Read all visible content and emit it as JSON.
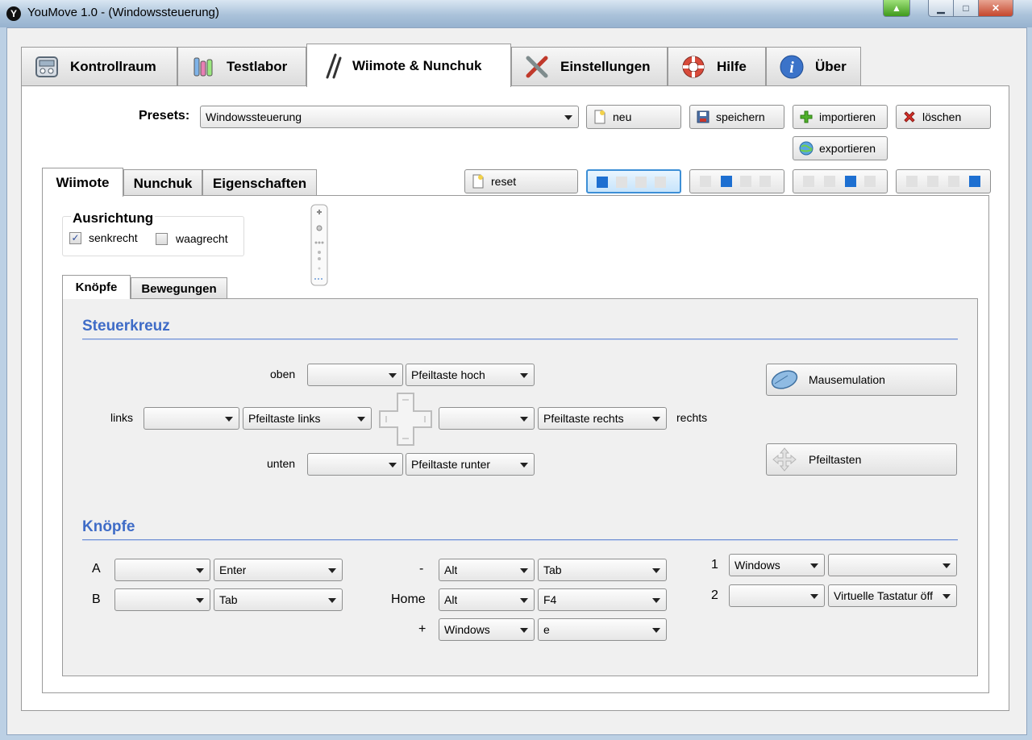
{
  "window": {
    "title": "YouMove 1.0 - (Windowssteuerung)",
    "app_icon": "youmove-app-icon"
  },
  "main_tabs": [
    {
      "label": "Kontrollraum",
      "icon": "control-room-icon"
    },
    {
      "label": "Testlabor",
      "icon": "test-lab-icon"
    },
    {
      "label": "Wiimote & Nunchuk",
      "icon": "wiimote-icon",
      "active": true
    },
    {
      "label": "Einstellungen",
      "icon": "tools-icon"
    },
    {
      "label": "Hilfe",
      "icon": "lifebuoy-icon"
    },
    {
      "label": "Über",
      "icon": "info-icon"
    }
  ],
  "presets": {
    "label": "Presets:",
    "selected": "Windowssteuerung",
    "new_label": "neu",
    "save_label": "speichern",
    "import_label": "importieren",
    "delete_label": "löschen",
    "export_label": "exportieren",
    "reset_label": "reset"
  },
  "sub_tabs": [
    {
      "label": "Wiimote",
      "active": true
    },
    {
      "label": "Nunchuk"
    },
    {
      "label": "Eigenschaften"
    }
  ],
  "orientation": {
    "title": "Ausrichtung",
    "vertical_label": "senkrecht",
    "vertical_checked": true,
    "horizontal_label": "waagrecht",
    "horizontal_checked": false
  },
  "inner_tabs": [
    {
      "label": "Knöpfe",
      "active": true
    },
    {
      "label": "Bewegungen"
    }
  ],
  "dpad": {
    "title": "Steuerkreuz",
    "up_label": "oben",
    "up_key": "Pfeiltaste hoch",
    "left_label": "links",
    "left_key": "Pfeiltaste links",
    "right_label": "rechts",
    "right_key": "Pfeiltaste rechts",
    "down_label": "unten",
    "down_key": "Pfeiltaste runter",
    "mouse_emulation_label": "Mausemulation",
    "arrow_keys_label": "Pfeiltasten"
  },
  "buttons": {
    "title": "Knöpfe",
    "rows": [
      {
        "label": "A",
        "mod": "",
        "key": "Enter"
      },
      {
        "label": "B",
        "mod": "",
        "key": "Tab"
      },
      {
        "label": "-",
        "mod": "Alt",
        "key": "Tab"
      },
      {
        "label": "Home",
        "mod": "Alt",
        "key": "F4"
      },
      {
        "label": "+",
        "mod": "Windows",
        "key": "e"
      },
      {
        "label": "1",
        "mod": "Windows",
        "key": ""
      },
      {
        "label": "2",
        "mod": "",
        "key": "Virtuelle Tastatur öff"
      }
    ]
  },
  "colors": {
    "accent": "#3f6cc7",
    "selected_border": "#3d8fd6",
    "led_on": "#1d6fd1"
  }
}
